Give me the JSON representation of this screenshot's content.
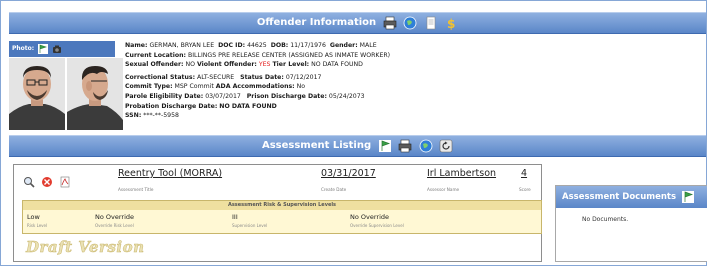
{
  "offender_header": {
    "title": "Offender Information",
    "icons": [
      "printer-icon",
      "globe-icon",
      "document-icon",
      "dollar-icon"
    ]
  },
  "photo_label": "Photo:",
  "offender": {
    "name_label": "Name:",
    "name": "GERMAN, BRYAN LEE",
    "docid_label": "DOC ID:",
    "docid": "44625",
    "dob_label": "DOB:",
    "dob": "11/17/1976",
    "gender_label": "Gender:",
    "gender": "MALE",
    "location_label": "Current Location:",
    "location": "BILLINGS PRE RELEASE CENTER (ASSIGNED AS INMATE WORKER)",
    "sex_label": "Sexual Offender:",
    "sex": "NO",
    "violent_label": "Violent Offender:",
    "violent": "YES",
    "tier_label": "Tier Level:",
    "tier": "NO DATA FOUND",
    "corr_label": "Correctional Status:",
    "corr": "ALT-SECURE",
    "status_date_label": "Status Date:",
    "status_date": "07/12/2017",
    "commit_label": "Commit Type:",
    "commit": "MSP Commit",
    "ada_label": "ADA Accommodations:",
    "ada": "No",
    "parole_label": "Parole Eligibility Date:",
    "parole": "03/07/2017",
    "discharge_label": "Prison Discharge Date:",
    "discharge": "05/24/2073",
    "probation_label": "Probation Discharge Date:",
    "probation": "NO DATA FOUND",
    "ssn_label": "SSN:",
    "ssn": "***-**-5958"
  },
  "listing_header": {
    "title": "Assessment Listing"
  },
  "assessment": {
    "title": "Reentry Tool (MORRA)",
    "title_label": "Assessment Title",
    "date": "03/31/2017",
    "date_label": "Create Date",
    "assessor": "Irl Lambertson",
    "assessor_label": "Assessor Name",
    "score": "4",
    "score_label": "Score",
    "risk_title": "Assessment Risk & Supervision Levels",
    "risk_level": "Low",
    "risk_level_label": "Risk Level",
    "override_risk": "No Override",
    "override_risk_label": "Override Risk Level",
    "supervision": "III",
    "supervision_label": "Supervision Level",
    "override_supervision": "No Override",
    "override_supervision_label": "Override Supervision Level",
    "draft": "Draft Version"
  },
  "documents": {
    "title": "Assessment Documents",
    "empty": "No Documents."
  },
  "colors": {
    "header_bar": "#5a86c8",
    "violent_yes": "#e31b1b",
    "risk_panel": "#fff8d4"
  }
}
